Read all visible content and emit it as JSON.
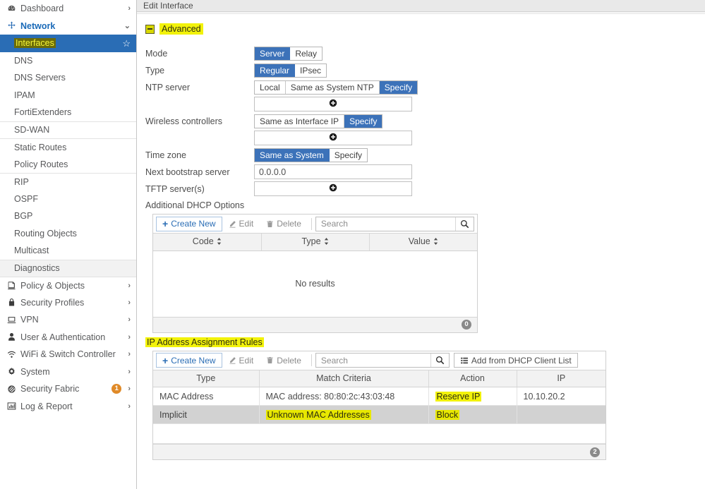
{
  "sidebar": {
    "items": [
      {
        "label": "Dashboard",
        "icon": "dashboard-icon",
        "kind": "group",
        "chevron": "right"
      },
      {
        "label": "Network",
        "icon": "network-icon",
        "kind": "group",
        "chevron": "down",
        "open": true
      },
      {
        "label": "Interfaces",
        "icon": "",
        "kind": "sub",
        "selected": true,
        "highlighted": true,
        "star": true
      },
      {
        "label": "DNS",
        "icon": "",
        "kind": "sub"
      },
      {
        "label": "DNS Servers",
        "icon": "",
        "kind": "sub"
      },
      {
        "label": "IPAM",
        "icon": "",
        "kind": "sub"
      },
      {
        "label": "FortiExtenders",
        "icon": "",
        "kind": "sub"
      },
      {
        "label": "SD-WAN",
        "icon": "",
        "kind": "sub",
        "divider": true
      },
      {
        "label": "Static Routes",
        "icon": "",
        "kind": "sub",
        "divider": true
      },
      {
        "label": "Policy Routes",
        "icon": "",
        "kind": "sub"
      },
      {
        "label": "RIP",
        "icon": "",
        "kind": "sub",
        "divider": true
      },
      {
        "label": "OSPF",
        "icon": "",
        "kind": "sub"
      },
      {
        "label": "BGP",
        "icon": "",
        "kind": "sub"
      },
      {
        "label": "Routing Objects",
        "icon": "",
        "kind": "sub"
      },
      {
        "label": "Multicast",
        "icon": "",
        "kind": "sub"
      },
      {
        "label": "Diagnostics",
        "icon": "",
        "kind": "sub",
        "divider": true,
        "shaded": true
      },
      {
        "label": "Policy & Objects",
        "icon": "policy-objects-icon",
        "kind": "group",
        "chevron": "right"
      },
      {
        "label": "Security Profiles",
        "icon": "lock-icon",
        "kind": "group",
        "chevron": "right"
      },
      {
        "label": "VPN",
        "icon": "monitor-icon",
        "kind": "group",
        "chevron": "right"
      },
      {
        "label": "User & Authentication",
        "icon": "user-icon",
        "kind": "group",
        "chevron": "right"
      },
      {
        "label": "WiFi & Switch Controller",
        "icon": "wifi-icon",
        "kind": "group",
        "chevron": "right"
      },
      {
        "label": "System",
        "icon": "gear-icon",
        "kind": "group",
        "chevron": "right"
      },
      {
        "label": "Security Fabric",
        "icon": "fabric-icon",
        "kind": "group",
        "chevron": "right",
        "badge": "1"
      },
      {
        "label": "Log & Report",
        "icon": "chart-icon",
        "kind": "group",
        "chevron": "right"
      }
    ]
  },
  "titlebar": {
    "title": "Edit Interface"
  },
  "advanced": {
    "section_title": "Advanced",
    "toggle_state": "expanded",
    "rows": {
      "mode": {
        "label": "Mode",
        "options": [
          "Server",
          "Relay"
        ],
        "selected": "Server"
      },
      "type": {
        "label": "Type",
        "options": [
          "Regular",
          "IPsec"
        ],
        "selected": "Regular"
      },
      "ntp_server": {
        "label": "NTP server",
        "options": [
          "Local",
          "Same as System NTP",
          "Specify"
        ],
        "selected": "Specify"
      },
      "wireless": {
        "label": "Wireless controllers",
        "options": [
          "Same as Interface IP",
          "Specify"
        ],
        "selected": "Specify"
      },
      "time_zone": {
        "label": "Time zone",
        "options": [
          "Same as System",
          "Specify"
        ],
        "selected": "Same as System"
      },
      "bootstrap": {
        "label": "Next bootstrap server",
        "value": "0.0.0.0"
      },
      "tftp": {
        "label": "TFTP server(s)"
      }
    }
  },
  "dhcp_options": {
    "title": "Additional DHCP Options",
    "toolbar": {
      "create_new": "Create New",
      "edit": "Edit",
      "delete": "Delete",
      "search_placeholder": "Search"
    },
    "columns": [
      "Code",
      "Type",
      "Value"
    ],
    "rows": [],
    "empty_text": "No results",
    "count": "0"
  },
  "ip_rules": {
    "title": "IP Address Assignment Rules",
    "title_highlighted": true,
    "toolbar": {
      "create_new": "Create New",
      "edit": "Edit",
      "delete": "Delete",
      "search_placeholder": "Search",
      "add_from_dhcp": "Add from DHCP Client List"
    },
    "columns": [
      "Type",
      "Match Criteria",
      "Action",
      "IP"
    ],
    "rows": [
      {
        "type": "MAC Address",
        "match": "MAC address: 80:80:2c:43:03:48",
        "action": "Reserve IP",
        "ip": "10.10.20.2",
        "action_highlighted": true,
        "match_highlighted": false,
        "implicit": false
      },
      {
        "type": "Implicit",
        "match": "Unknown MAC Addresses",
        "action": "Block",
        "ip": "",
        "action_highlighted": true,
        "match_highlighted": true,
        "implicit": true
      }
    ],
    "count": "2"
  },
  "colors": {
    "accent_blue": "#3c72b9",
    "selected_nav": "#2a6db5",
    "highlight_yellow": "#f2f20a",
    "badge_orange": "#e08a28",
    "implicit_row": "#d2d2d2",
    "link_blue": "#2a6db5"
  }
}
